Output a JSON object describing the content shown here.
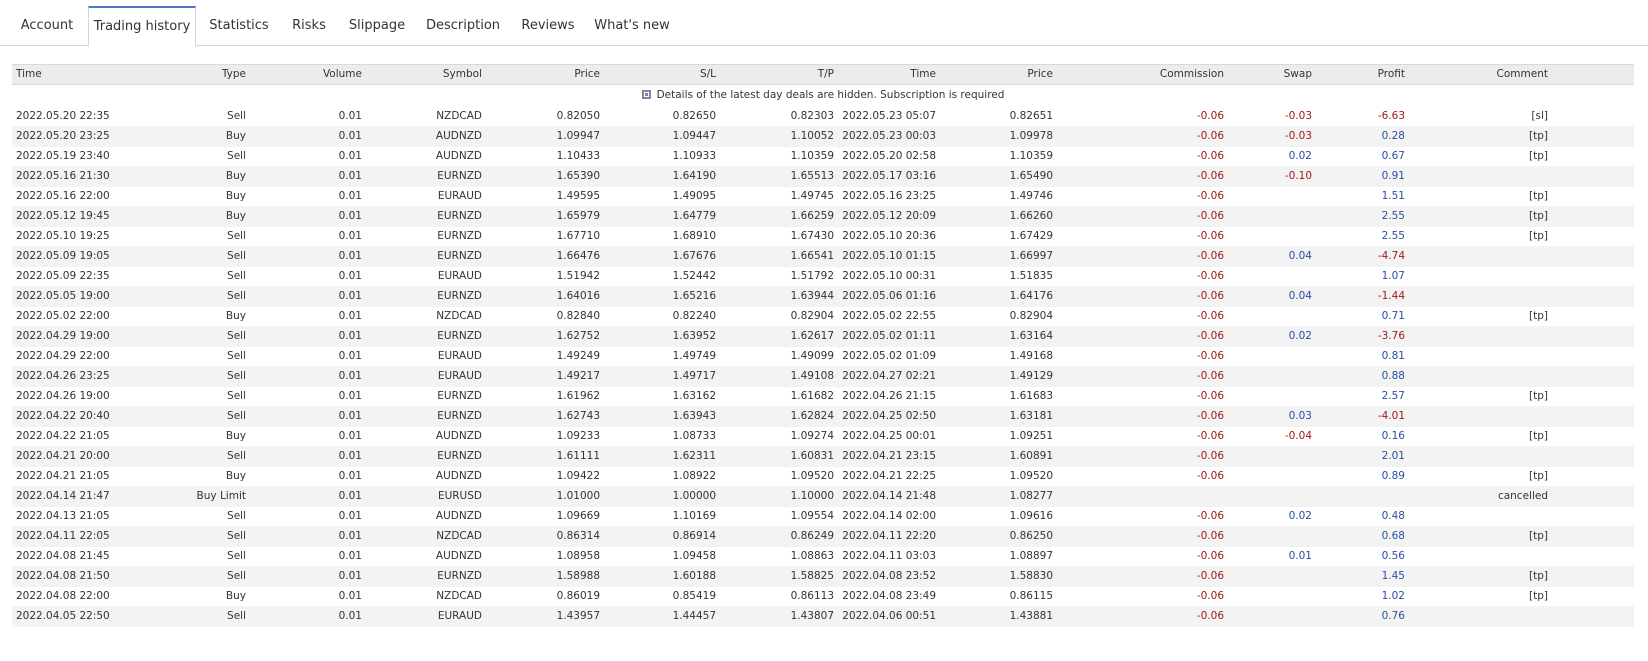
{
  "tabs": [
    {
      "label": "Account"
    },
    {
      "label": "Trading history"
    },
    {
      "label": "Statistics"
    },
    {
      "label": "Risks"
    },
    {
      "label": "Slippage"
    },
    {
      "label": "Description"
    },
    {
      "label": "Reviews"
    },
    {
      "label": "What's new"
    }
  ],
  "active_tab": "Trading history",
  "table": {
    "headers": [
      "Time",
      "Type",
      "Volume",
      "Symbol",
      "Price",
      "S/L",
      "T/P",
      "Time",
      "Price",
      "Commission",
      "Swap",
      "Profit",
      "Comment"
    ],
    "notice": "Details of the latest day deals are hidden. Subscription is required",
    "rows": [
      [
        "2022.05.20 22:35",
        "Sell",
        "0.01",
        "NZDCAD",
        "0.82050",
        "0.82650",
        "0.82303",
        "2022.05.23 05:07",
        "0.82651",
        "-0.06",
        "-0.03",
        "-6.63",
        "[sl]"
      ],
      [
        "2022.05.20 23:25",
        "Buy",
        "0.01",
        "AUDNZD",
        "1.09947",
        "1.09447",
        "1.10052",
        "2022.05.23 00:03",
        "1.09978",
        "-0.06",
        "-0.03",
        "0.28",
        "[tp]"
      ],
      [
        "2022.05.19 23:40",
        "Sell",
        "0.01",
        "AUDNZD",
        "1.10433",
        "1.10933",
        "1.10359",
        "2022.05.20 02:58",
        "1.10359",
        "-0.06",
        "0.02",
        "0.67",
        "[tp]"
      ],
      [
        "2022.05.16 21:30",
        "Buy",
        "0.01",
        "EURNZD",
        "1.65390",
        "1.64190",
        "1.65513",
        "2022.05.17 03:16",
        "1.65490",
        "-0.06",
        "-0.10",
        "0.91",
        ""
      ],
      [
        "2022.05.16 22:00",
        "Buy",
        "0.01",
        "EURAUD",
        "1.49595",
        "1.49095",
        "1.49745",
        "2022.05.16 23:25",
        "1.49746",
        "-0.06",
        "",
        "1.51",
        "[tp]"
      ],
      [
        "2022.05.12 19:45",
        "Buy",
        "0.01",
        "EURNZD",
        "1.65979",
        "1.64779",
        "1.66259",
        "2022.05.12 20:09",
        "1.66260",
        "-0.06",
        "",
        "2.55",
        "[tp]"
      ],
      [
        "2022.05.10 19:25",
        "Sell",
        "0.01",
        "EURNZD",
        "1.67710",
        "1.68910",
        "1.67430",
        "2022.05.10 20:36",
        "1.67429",
        "-0.06",
        "",
        "2.55",
        "[tp]"
      ],
      [
        "2022.05.09 19:05",
        "Sell",
        "0.01",
        "EURNZD",
        "1.66476",
        "1.67676",
        "1.66541",
        "2022.05.10 01:15",
        "1.66997",
        "-0.06",
        "0.04",
        "-4.74",
        ""
      ],
      [
        "2022.05.09 22:35",
        "Sell",
        "0.01",
        "EURAUD",
        "1.51942",
        "1.52442",
        "1.51792",
        "2022.05.10 00:31",
        "1.51835",
        "-0.06",
        "",
        "1.07",
        ""
      ],
      [
        "2022.05.05 19:00",
        "Sell",
        "0.01",
        "EURNZD",
        "1.64016",
        "1.65216",
        "1.63944",
        "2022.05.06 01:16",
        "1.64176",
        "-0.06",
        "0.04",
        "-1.44",
        ""
      ],
      [
        "2022.05.02 22:00",
        "Buy",
        "0.01",
        "NZDCAD",
        "0.82840",
        "0.82240",
        "0.82904",
        "2022.05.02 22:55",
        "0.82904",
        "-0.06",
        "",
        "0.71",
        "[tp]"
      ],
      [
        "2022.04.29 19:00",
        "Sell",
        "0.01",
        "EURNZD",
        "1.62752",
        "1.63952",
        "1.62617",
        "2022.05.02 01:11",
        "1.63164",
        "-0.06",
        "0.02",
        "-3.76",
        ""
      ],
      [
        "2022.04.29 22:00",
        "Sell",
        "0.01",
        "EURAUD",
        "1.49249",
        "1.49749",
        "1.49099",
        "2022.05.02 01:09",
        "1.49168",
        "-0.06",
        "",
        "0.81",
        ""
      ],
      [
        "2022.04.26 23:25",
        "Sell",
        "0.01",
        "EURAUD",
        "1.49217",
        "1.49717",
        "1.49108",
        "2022.04.27 02:21",
        "1.49129",
        "-0.06",
        "",
        "0.88",
        ""
      ],
      [
        "2022.04.26 19:00",
        "Sell",
        "0.01",
        "EURNZD",
        "1.61962",
        "1.63162",
        "1.61682",
        "2022.04.26 21:15",
        "1.61683",
        "-0.06",
        "",
        "2.57",
        "[tp]"
      ],
      [
        "2022.04.22 20:40",
        "Sell",
        "0.01",
        "EURNZD",
        "1.62743",
        "1.63943",
        "1.62824",
        "2022.04.25 02:50",
        "1.63181",
        "-0.06",
        "0.03",
        "-4.01",
        ""
      ],
      [
        "2022.04.22 21:05",
        "Buy",
        "0.01",
        "AUDNZD",
        "1.09233",
        "1.08733",
        "1.09274",
        "2022.04.25 00:01",
        "1.09251",
        "-0.06",
        "-0.04",
        "0.16",
        "[tp]"
      ],
      [
        "2022.04.21 20:00",
        "Sell",
        "0.01",
        "EURNZD",
        "1.61111",
        "1.62311",
        "1.60831",
        "2022.04.21 23:15",
        "1.60891",
        "-0.06",
        "",
        "2.01",
        ""
      ],
      [
        "2022.04.21 21:05",
        "Buy",
        "0.01",
        "AUDNZD",
        "1.09422",
        "1.08922",
        "1.09520",
        "2022.04.21 22:25",
        "1.09520",
        "-0.06",
        "",
        "0.89",
        "[tp]"
      ],
      [
        "2022.04.14 21:47",
        "Buy Limit",
        "0.01",
        "EURUSD",
        "1.01000",
        "1.00000",
        "1.10000",
        "2022.04.14 21:48",
        "1.08277",
        "",
        "",
        "",
        "cancelled"
      ],
      [
        "2022.04.13 21:05",
        "Sell",
        "0.01",
        "AUDNZD",
        "1.09669",
        "1.10169",
        "1.09554",
        "2022.04.14 02:00",
        "1.09616",
        "-0.06",
        "0.02",
        "0.48",
        ""
      ],
      [
        "2022.04.11 22:05",
        "Sell",
        "0.01",
        "NZDCAD",
        "0.86314",
        "0.86914",
        "0.86249",
        "2022.04.11 22:20",
        "0.86250",
        "-0.06",
        "",
        "0.68",
        "[tp]"
      ],
      [
        "2022.04.08 21:45",
        "Sell",
        "0.01",
        "AUDNZD",
        "1.08958",
        "1.09458",
        "1.08863",
        "2022.04.11 03:03",
        "1.08897",
        "-0.06",
        "0.01",
        "0.56",
        ""
      ],
      [
        "2022.04.08 21:50",
        "Sell",
        "0.01",
        "EURNZD",
        "1.58988",
        "1.60188",
        "1.58825",
        "2022.04.08 23:52",
        "1.58830",
        "-0.06",
        "",
        "1.45",
        "[tp]"
      ],
      [
        "2022.04.08 22:00",
        "Buy",
        "0.01",
        "NZDCAD",
        "0.86019",
        "0.85419",
        "0.86113",
        "2022.04.08 23:49",
        "0.86115",
        "-0.06",
        "",
        "1.02",
        "[tp]"
      ],
      [
        "2022.04.05 22:50",
        "Sell",
        "0.01",
        "EURAUD",
        "1.43957",
        "1.44457",
        "1.43807",
        "2022.04.06 00:51",
        "1.43881",
        "-0.06",
        "",
        "0.76",
        ""
      ]
    ]
  },
  "colors": {
    "negative": "#a11a1a",
    "positive": "#2a4fa0",
    "tab_accent": "#4a78c2"
  }
}
